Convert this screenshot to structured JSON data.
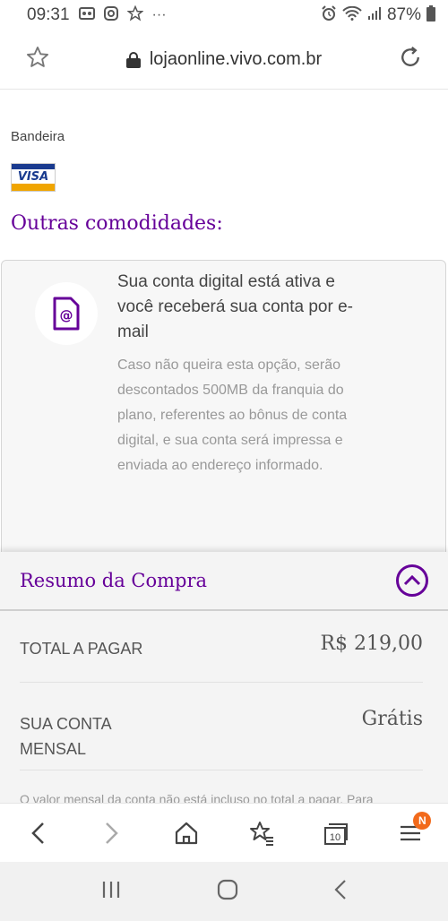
{
  "status_bar": {
    "time": "09:31",
    "battery": "87%",
    "left_icons": [
      "voicemail-icon",
      "instagram-icon",
      "star-icon",
      "more-icon"
    ],
    "right_icons": [
      "alarm-icon",
      "wifi-icon",
      "signal-icon",
      "battery-icon"
    ]
  },
  "url_bar": {
    "url": "lojaonline.vivo.com.br"
  },
  "page": {
    "flag_label": "Bandeira",
    "card_brand": "VISA",
    "section_title": "Outras comodidades:",
    "info_card": {
      "title": "Sua conta digital está ativa e você receberá sua conta por e-mail",
      "description": "Caso não queira esta opção, serão descontados 500MB da franquia do plano, referentes ao bônus de conta digital, e sua conta será impressa e enviada ao endereço informado."
    }
  },
  "resumo": {
    "title": "Resumo da Compra",
    "total_label": "TOTAL A PAGAR",
    "total_value": "R$ 219,00",
    "conta_label": "SUA CONTA MENSAL",
    "conta_value": "Grátis",
    "note": "O valor mensal da conta não está incluso no total a pagar. Para"
  },
  "toolbar": {
    "tabs_count": "10",
    "menu_badge": "N"
  },
  "colors": {
    "brand_purple": "#660099",
    "badge_orange": "#f26a1b"
  }
}
